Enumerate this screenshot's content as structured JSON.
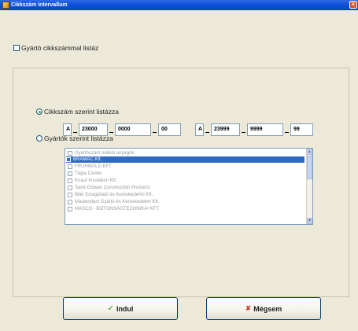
{
  "window": {
    "title": "Cikkszám intervallum",
    "close_glyph": "x"
  },
  "manufacturer_checkbox": {
    "label": "Gyártó cikkszámmal listáz",
    "checked": false
  },
  "by_code": {
    "label": "Cikkszám szerint listázza",
    "selected": true,
    "from": {
      "prefix": "A",
      "part1": "23000",
      "part2": "0000",
      "part3": "00"
    },
    "to": {
      "prefix": "A",
      "part1": "23999",
      "part2": "9999",
      "part3": "99"
    }
  },
  "by_manufacturer": {
    "label": "Gyártók szerint listázza",
    "selected": false,
    "items": [
      {
        "label": "Gyártószám nélküli anyagok",
        "selected": false
      },
      {
        "label": "BRAMAC Kft.",
        "selected": true
      },
      {
        "label": "FRUHWALD KFT.",
        "selected": false
      },
      {
        "label": "Tégla Center",
        "selected": false
      },
      {
        "label": "Knauf Insulation Kft.",
        "selected": false
      },
      {
        "label": "Saint-Gobain Construction Products",
        "selected": false
      },
      {
        "label": "Bilel Szolgáltató és Kereskedelmi Kft.",
        "selected": false
      },
      {
        "label": "Masterplast Gyártó és Kereskedelmi Kft.",
        "selected": false
      },
      {
        "label": "MASCO - BIZTONSÁGTECHNIKAI KFT.",
        "selected": false
      }
    ]
  },
  "buttons": {
    "ok": {
      "label": "Indul",
      "icon": "check-icon"
    },
    "cancel": {
      "label": "Mégsem",
      "icon": "x-icon"
    }
  },
  "colors": {
    "title_bar": "#0a4ed8",
    "selection": "#316ac5",
    "ok_check": "#2d9d1f",
    "cancel_x": "#c9211d"
  }
}
